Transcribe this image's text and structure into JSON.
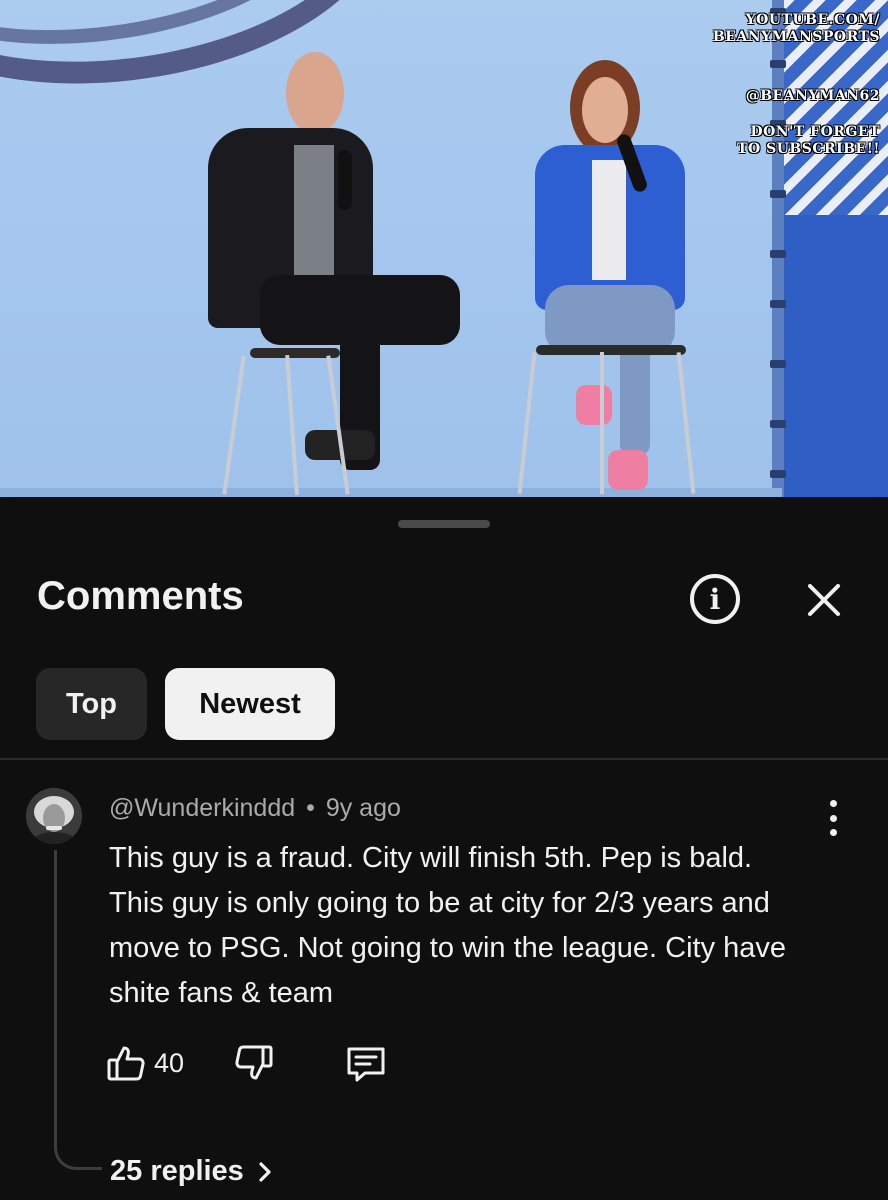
{
  "video": {
    "overlay": {
      "channel_url_line1": "YOUTUBE.COM/",
      "channel_url_line2": "BEANYMANSPORTS",
      "handle": "@BEANYMAN62",
      "cta_line1": "DON'T FORGET",
      "cta_line2": "TO SUBSCRIBE!!"
    }
  },
  "comments_panel": {
    "title": "Comments",
    "info_icon": "info-circle-icon",
    "close_icon": "close-icon",
    "sort": {
      "options": [
        "Top",
        "Newest"
      ],
      "selected": "Newest"
    },
    "comments": [
      {
        "author": "@Wunderkinddd",
        "separator": "•",
        "time": "9y ago",
        "text": "This guy is a fraud. City will finish 5th. Pep is bald. This guy is only going to be at city for 2/3 years and move to PSG. Not going to win the league. City have shite fans & team",
        "likes": "40",
        "replies_label": "25 replies",
        "icons": {
          "like": "thumbs-up-icon",
          "dislike": "thumbs-down-icon",
          "reply": "comment-reply-icon",
          "more": "more-vertical-icon",
          "chevron": "chevron-right-icon"
        }
      }
    ]
  },
  "colors": {
    "background": "#0f0f0f",
    "chip_selected_bg": "#f1f1f1",
    "chip_bg": "#272727",
    "secondary_text": "#aaaaaa",
    "primary_text": "#f1f1f1"
  }
}
